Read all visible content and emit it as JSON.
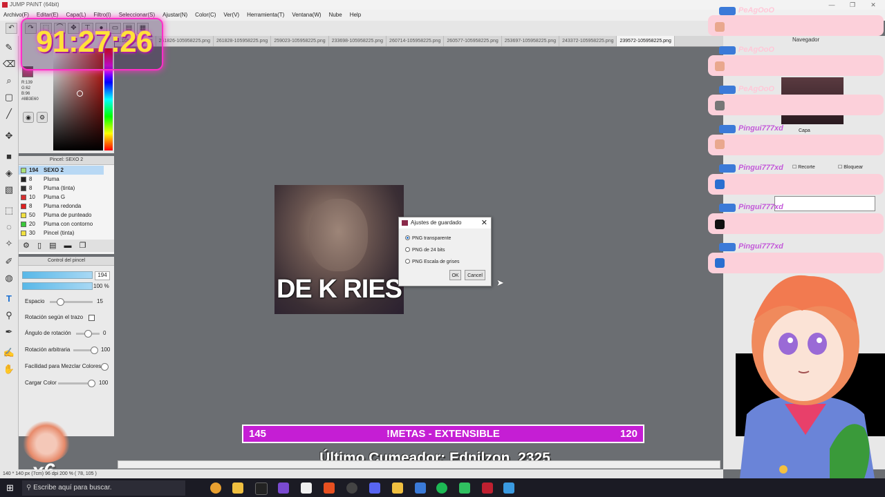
{
  "window": {
    "title": "JUMP PAINT (64bit)",
    "minimize": "—",
    "maximize": "❐",
    "close": "✕"
  },
  "menu": [
    "Archivo(F)",
    "Editar(E)",
    "Capa(L)",
    "Filtro(I)",
    "Seleccionar(S)",
    "Ajustar(N)",
    "Color(C)",
    "Ver(V)",
    "Herramienta(T)",
    "Ventana(W)",
    "Nube",
    "Help"
  ],
  "tabs": [
    "...10595825.png",
    "261826-105958225.png",
    "261828-105958225.png",
    "259023-105958225.png",
    "233698-105958225.png",
    "260714-105958225.png",
    "260577-105958225.png",
    "253697-105958225.png",
    "243372-105958225.png",
    "239572-105958225.png"
  ],
  "active_tab_index": 9,
  "color_panel": {
    "r": "R:139",
    "g": "G:62",
    "b": "B:96",
    "hex": "#8B3E60"
  },
  "brush_panel": {
    "title": "Pincel: SEXO 2",
    "items": [
      {
        "size": "194",
        "name": "SEXO 2",
        "color": "#a8e07a",
        "selected": true
      },
      {
        "size": "8",
        "name": "Pluma",
        "color": "#222222"
      },
      {
        "size": "8",
        "name": "Pluma (tinta)",
        "color": "#333333"
      },
      {
        "size": "10",
        "name": "Pluma G",
        "color": "#d83030"
      },
      {
        "size": "8",
        "name": "Pluma redonda",
        "color": "#e02020"
      },
      {
        "size": "50",
        "name": "Pluma de punteado",
        "color": "#f0e040"
      },
      {
        "size": "20",
        "name": "Pluma con contorno",
        "color": "#3ac83a"
      },
      {
        "size": "30",
        "name": "Pincel (tinta)",
        "color": "#f0e040"
      }
    ]
  },
  "brush_control": {
    "title": "Control del pincel",
    "size_value": "194",
    "opacity_value": "100 %",
    "rows": [
      {
        "label": "Espacio",
        "value": "15",
        "level": 0.1
      },
      {
        "label": "Rotación según el trazo",
        "value": ""
      },
      {
        "label": "Ángulo de rotación",
        "value": "0",
        "level": 0.5
      },
      {
        "label": "Rotación arbitraria",
        "value": "100",
        "level": 1.0
      },
      {
        "label": "Facilidad para Mezclar Colores",
        "value": "",
        "level": 0.0
      },
      {
        "label": "Cargar Color",
        "value": "100",
        "level": 1.0
      }
    ]
  },
  "canvas": {
    "meme_text": "DE K RIES"
  },
  "dialog": {
    "title": "Ajustes de guardado",
    "options": [
      {
        "label": "PNG transparente",
        "checked": true
      },
      {
        "label": "PNG de 24 bits",
        "checked": false
      },
      {
        "label": "PNG Escala de grises",
        "checked": false
      }
    ],
    "ok": "OK",
    "cancel": "Cancel",
    "close": "✕"
  },
  "right_panel": {
    "navigator": "Navegador",
    "layer": "Capa",
    "recorte": "Recorte",
    "bloquear": "Bloquear"
  },
  "chat": [
    {
      "name": "PeAgOoO",
      "color": "#ffd0e0"
    },
    {
      "name": "PeAgOoO",
      "color": "#ffd0e0"
    },
    {
      "name": "PeAgOoO",
      "color": "#ffd0e0"
    },
    {
      "name": "Pingui777xd",
      "color": "#c45ad9"
    },
    {
      "name": "Pingui777xd",
      "color": "#c45ad9"
    },
    {
      "name": "Pingui777xd",
      "color": "#c45ad9"
    },
    {
      "name": "Pingui777xd",
      "color": "#c45ad9"
    }
  ],
  "overlay": {
    "timer": "91:27:26",
    "goal_left": "145",
    "goal_center": "!METAS - EXTENSIBLE",
    "goal_right": "120",
    "cumeador": "Último Cumeador: Ednilzon_2325",
    "multiplier": "x6"
  },
  "status": {
    "text": "140 * 140 px (7cm)  96 dpi  200 %  ( 78, 105 )"
  },
  "taskbar": {
    "search_placeholder": "Escribe aquí para buscar."
  }
}
